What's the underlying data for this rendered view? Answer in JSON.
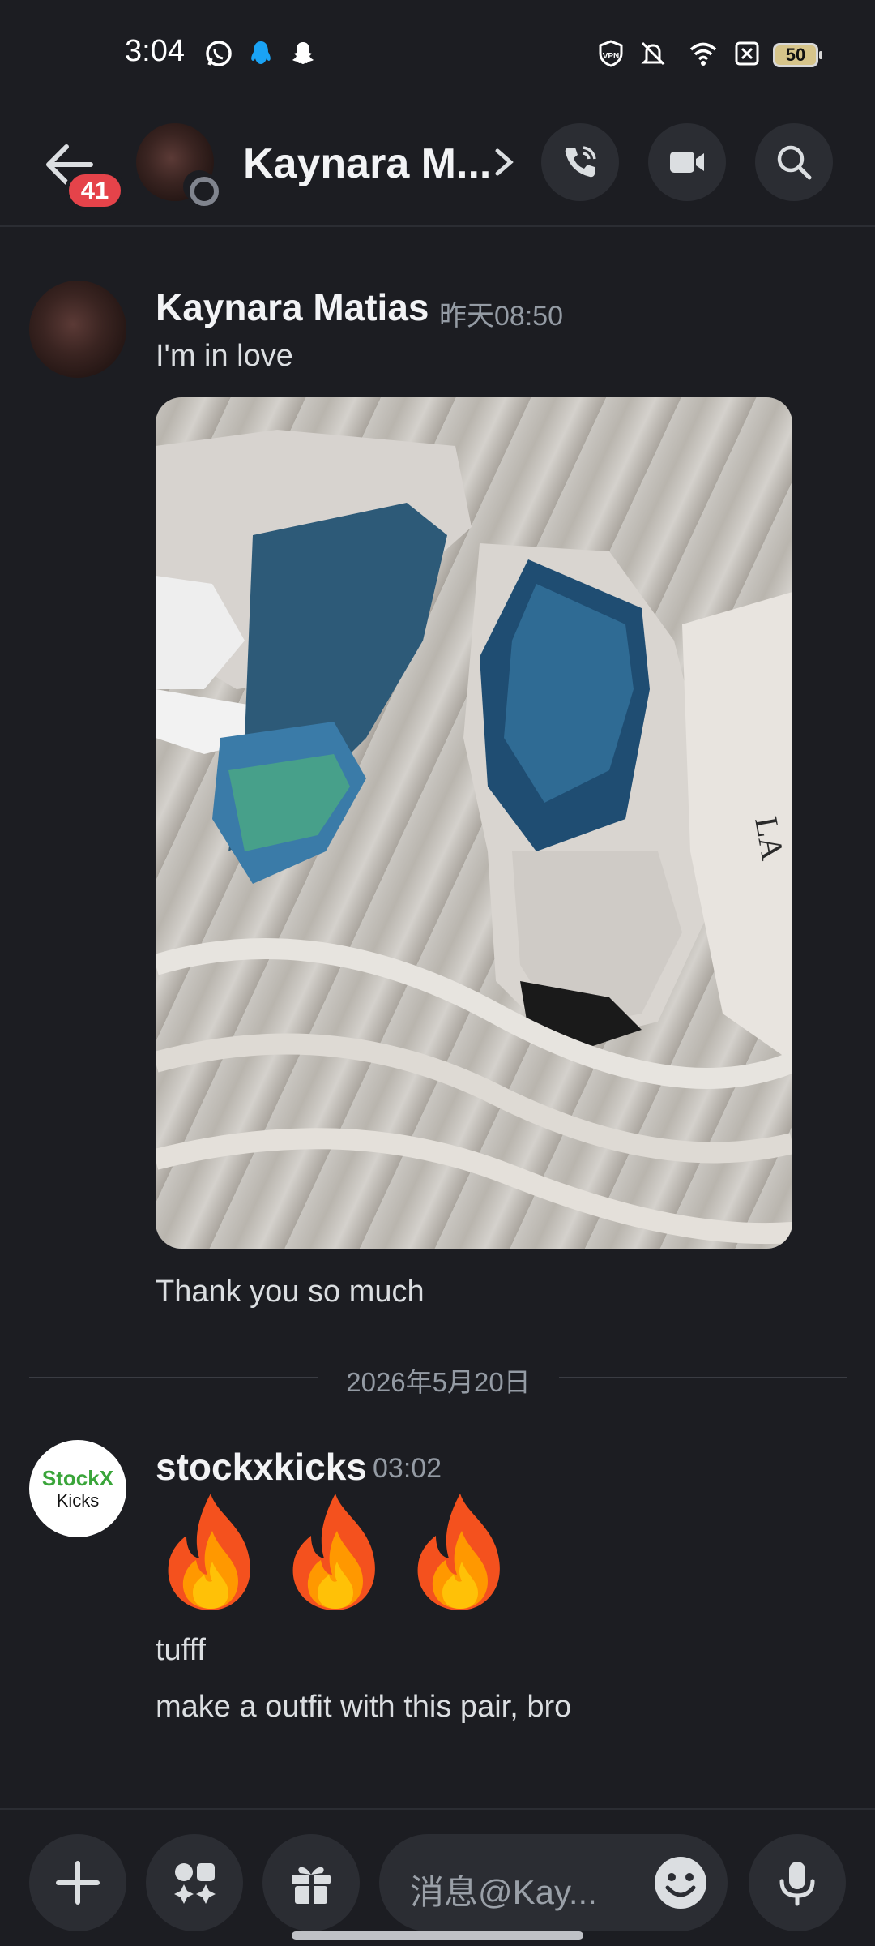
{
  "status_bar": {
    "time": "3:04",
    "battery": "50",
    "icons": [
      "whatsapp-icon",
      "qq-icon",
      "snapchat-icon",
      "vpn-icon",
      "mute-icon",
      "wifi-icon",
      "no-sim-icon",
      "battery-icon"
    ]
  },
  "header": {
    "unread_count": "41",
    "contact_name": "Kaynara M...",
    "actions": [
      "voice-call-icon",
      "video-call-icon",
      "search-icon"
    ]
  },
  "messages": [
    {
      "author": "Kaynara Matias",
      "time": "昨天08:50",
      "lines": [
        "I'm in love"
      ],
      "attachment": "photo",
      "after_attachment": "Thank you so much"
    },
    {
      "author": "stockxkicks",
      "time": "03:02",
      "emoji": [
        "🔥",
        "🔥",
        "🔥"
      ],
      "lines": [
        "tufff",
        "make a outfit with this pair, bro"
      ]
    }
  ],
  "date_divider": "2026年5月20日",
  "stockx_logo": {
    "line1": "StockX",
    "line2": "Kicks"
  },
  "composer": {
    "placeholder": "消息@Kay..."
  },
  "colors": {
    "background": "#1c1d22",
    "button_bg": "#2b2d33",
    "badge": "#e5434a",
    "muted_text": "#949ba4"
  }
}
